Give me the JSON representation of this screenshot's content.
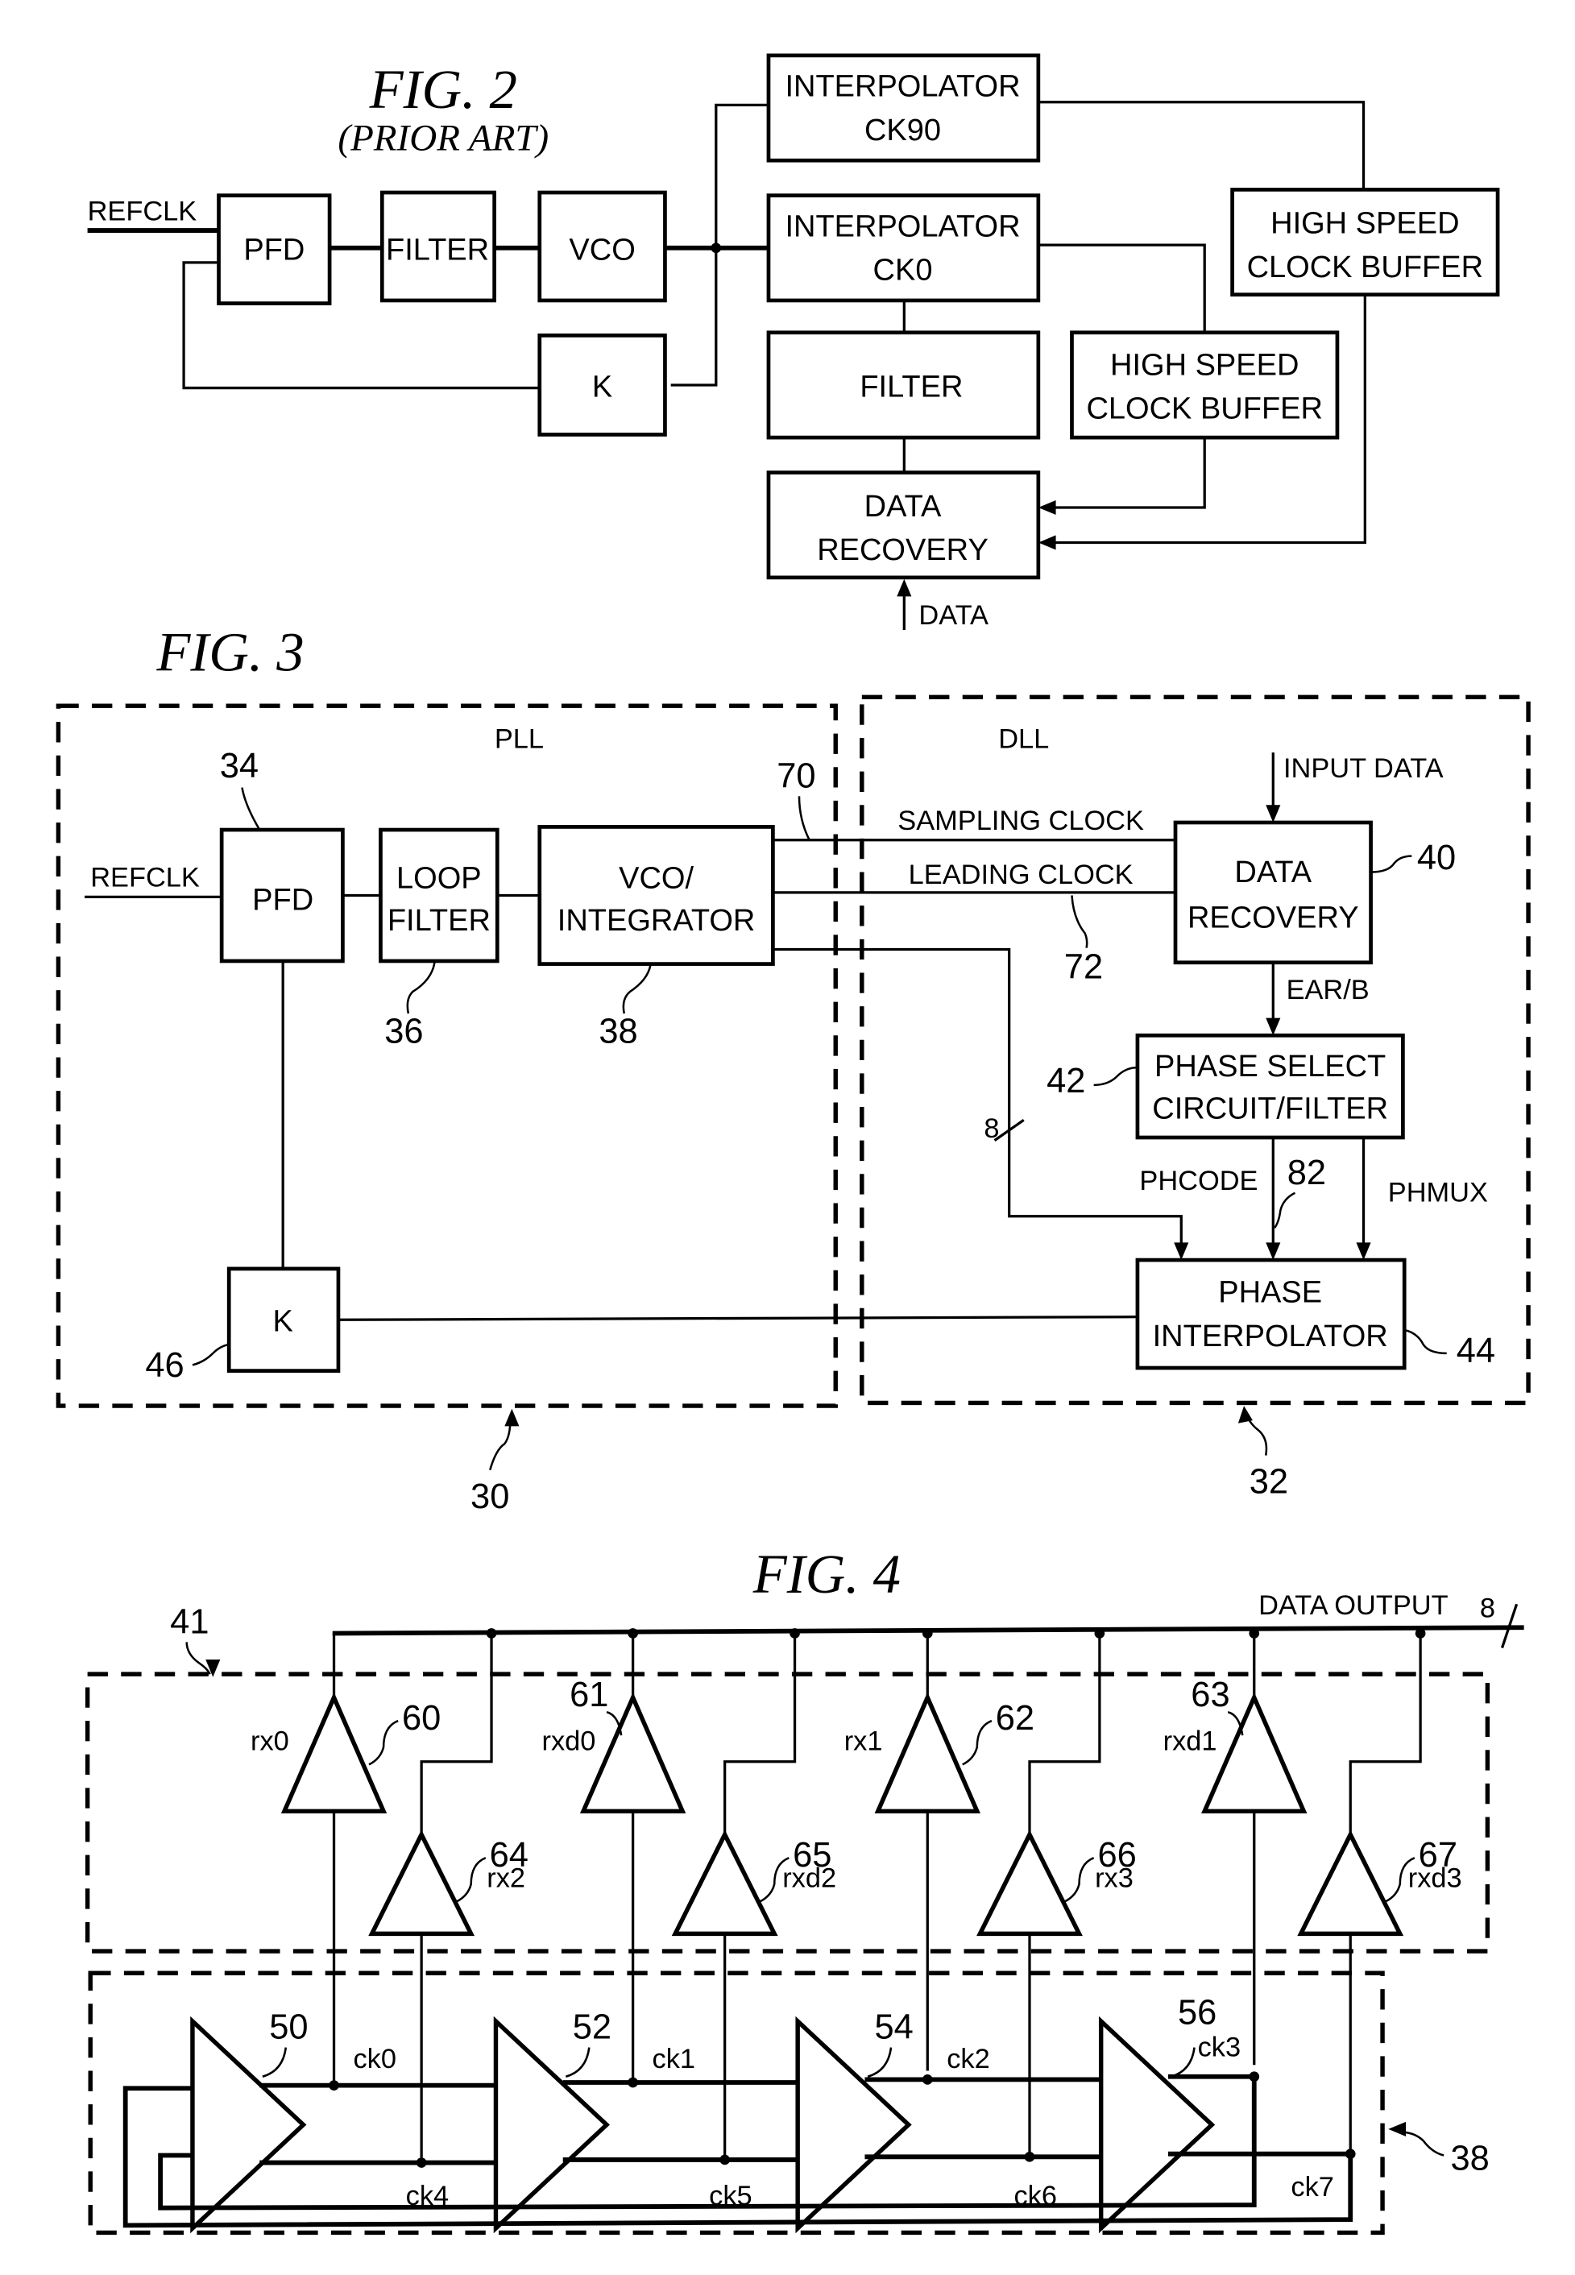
{
  "fig2": {
    "title": "FIG. 2",
    "subtitle": "(PRIOR ART)",
    "input_label": "REFCLK",
    "data_label": "DATA",
    "blocks": {
      "pfd": "PFD",
      "filter": "FILTER",
      "vco": "VCO",
      "k": "K",
      "interp90": [
        "INTERPOLATOR",
        "CK90"
      ],
      "interp0": [
        "INTERPOLATOR",
        "CK0"
      ],
      "filter2": "FILTER",
      "hscb1": [
        "HIGH SPEED",
        "CLOCK BUFFER"
      ],
      "hscb2": [
        "HIGH SPEED",
        "CLOCK BUFFER"
      ],
      "data_recovery": [
        "DATA",
        "RECOVERY"
      ]
    }
  },
  "fig3": {
    "title": "FIG. 3",
    "pll_label": "PLL",
    "dll_label": "DLL",
    "input_label": "REFCLK",
    "input_data_label": "INPUT DATA",
    "signals": {
      "sampling_clock": "SAMPLING CLOCK",
      "leading_clock": "LEADING CLOCK",
      "earb": "EAR/B",
      "phcode": "PHCODE",
      "phmux": "PHMUX",
      "bus_width": "8"
    },
    "blocks": {
      "pfd": "PFD",
      "loop_filter": [
        "LOOP",
        "FILTER"
      ],
      "vco_integrator": [
        "VCO/",
        "INTEGRATOR"
      ],
      "k": "K",
      "data_recovery": [
        "DATA",
        "RECOVERY"
      ],
      "phase_select": [
        "PHASE SELECT",
        "CIRCUIT/FILTER"
      ],
      "phase_interp": [
        "PHASE",
        "INTERPOLATOR"
      ]
    },
    "refs": {
      "pfd": "34",
      "loop_filter": "36",
      "vco": "38",
      "k": "46",
      "data_recovery": "40",
      "phase_select": "42",
      "phase_interp": "44",
      "sampling": "70",
      "leading": "72",
      "phcode_bus": "82",
      "pll": "30",
      "dll": "32"
    }
  },
  "fig4": {
    "title": "FIG. 4",
    "data_output_label": "DATA OUTPUT",
    "bus_width": "8",
    "receiver_block_ref": "41",
    "vco_block_ref": "38",
    "receivers": [
      {
        "ref": "60",
        "name": "rx0"
      },
      {
        "ref": "64",
        "name": "rx2"
      },
      {
        "ref": "61",
        "name": "rxd0"
      },
      {
        "ref": "65",
        "name": "rxd2"
      },
      {
        "ref": "62",
        "name": "rx1"
      },
      {
        "ref": "66",
        "name": "rx3"
      },
      {
        "ref": "63",
        "name": "rxd1"
      },
      {
        "ref": "67",
        "name": "rxd3"
      }
    ],
    "stages": [
      {
        "ref": "50",
        "out_top": "ck0",
        "out_bottom": "ck4"
      },
      {
        "ref": "52",
        "out_top": "ck1",
        "out_bottom": "ck5"
      },
      {
        "ref": "54",
        "out_top": "ck2",
        "out_bottom": "ck6"
      },
      {
        "ref": "56",
        "out_top": "ck3",
        "out_bottom": "ck7"
      }
    ]
  }
}
